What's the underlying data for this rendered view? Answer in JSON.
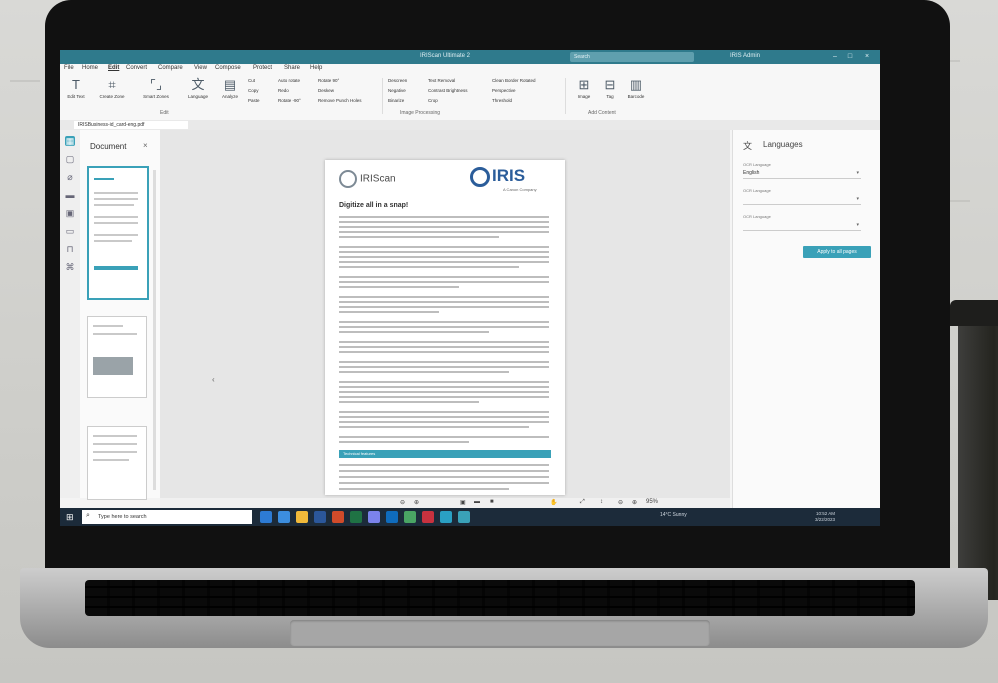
{
  "window": {
    "title": "IRIScan Ultimate 2",
    "search_placeholder": "Search",
    "user": "IRIS Admin",
    "controls": [
      "–",
      "□",
      "×"
    ]
  },
  "menu": [
    "File",
    "Home",
    "Edit",
    "Convert",
    "Compare",
    "View",
    "Compose",
    "Protect",
    "Share",
    "Help"
  ],
  "ribbon": {
    "big_buttons": [
      {
        "icon": "text-icon",
        "label": "Edit Text"
      },
      {
        "icon": "create-zone-icon",
        "label": "Create Zone"
      },
      {
        "icon": "smart-zones-icon",
        "label": "Smart Zones"
      },
      {
        "icon": "language-icon",
        "label": "Language"
      },
      {
        "icon": "analyze-icon",
        "label": "Analyze"
      }
    ],
    "edit_small": [
      "Cut",
      "Copy",
      "Paste",
      "Auto rotate",
      "Rotate 90°",
      "Redo",
      "Rotate -90°",
      "Deskew",
      "Remove Punch Holes"
    ],
    "image_small": [
      "Descreen",
      "Text Removal",
      "Negative",
      "Contrast Brightness",
      "Binarize",
      "Crop",
      "Clean Border Rotated",
      "Perspective",
      "Threshold"
    ],
    "right_buttons": [
      {
        "icon": "add-image-icon",
        "label": "Image"
      },
      {
        "icon": "ocr-icon",
        "label": "Tag"
      },
      {
        "icon": "barcode-icon",
        "label": "Barcode"
      }
    ],
    "groups": [
      "Edit",
      "Image Processing",
      "Add Content"
    ]
  },
  "tab": {
    "label": "IRISBusiness-id_card-eng.pdf"
  },
  "thumb_panel": {
    "title": "Document",
    "close": "×"
  },
  "page": {
    "logo_left": "IRIScan",
    "logo_right": "IRIS",
    "logo_sub": "A Canon Company",
    "heading": "Digitize all in a snap!",
    "banner": "Technical features"
  },
  "zoom": {
    "percent": "95%"
  },
  "lang_panel": {
    "title": "Languages",
    "fields": [
      {
        "label": "OCR Language",
        "value": "English"
      },
      {
        "label": "OCR Language",
        "value": ""
      },
      {
        "label": "OCR Language",
        "value": ""
      }
    ],
    "apply": "Apply to all pages"
  },
  "taskbar": {
    "search_placeholder": "Type here to search",
    "tray": "14°C  Sunny",
    "time": "10:52 AM",
    "date": "3/22/2023"
  },
  "colors": {
    "accent": "#3aa1b8",
    "titlebar": "#2f7a8c",
    "taskbar": "#1c2b3a"
  }
}
